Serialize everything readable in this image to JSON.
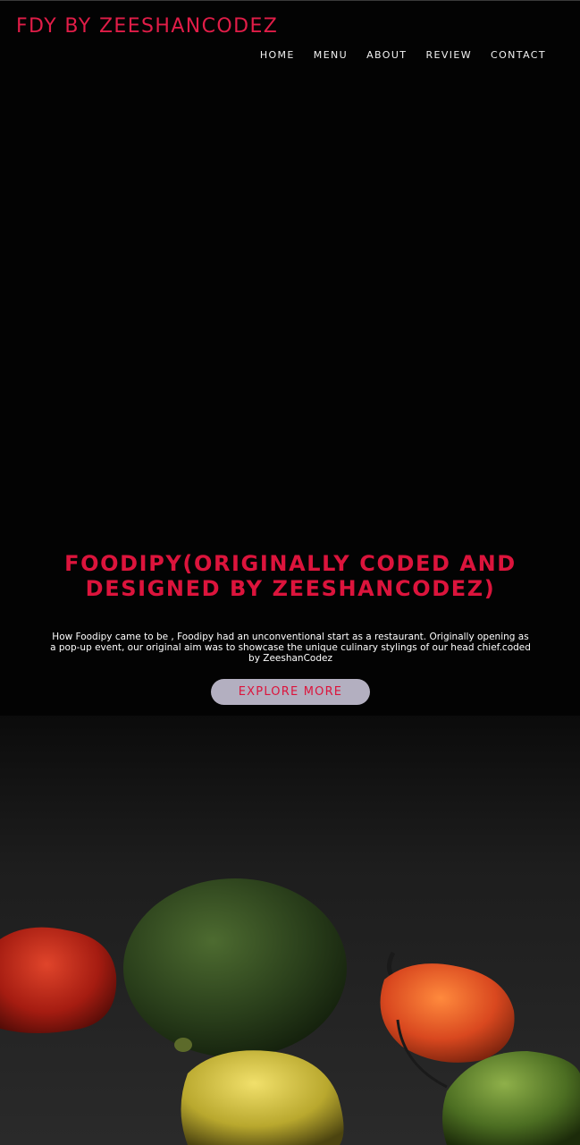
{
  "header": {
    "brand": "FDY BY ZEESHANCODEZ",
    "nav": {
      "home": "HOME",
      "menu": "MENU",
      "about": "ABOUT",
      "review": "REVIEW",
      "contact": "CONTACT"
    }
  },
  "hero": {
    "title": "FOODIPY(ORIGINALLY CODED AND DESIGNED BY ZEESHANCODEZ)",
    "description": "How Foodipy came to be , Foodipy had an unconventional start as a restaurant. Originally opening as a pop-up event, our original aim was to showcase the unique culinary stylings of our head chief.coded by ZeeshanCodez",
    "cta_label": "EXPLORE MORE"
  },
  "colors": {
    "accent": "#dc143c",
    "button_bg": "#b3afc0",
    "background": "#000000"
  }
}
